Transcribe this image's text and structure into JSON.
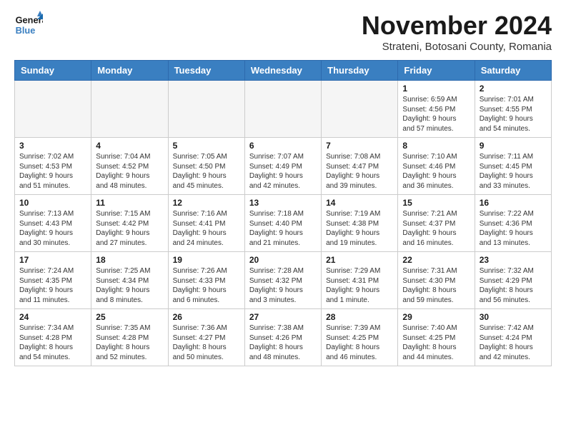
{
  "logo": {
    "text_general": "General",
    "text_blue": "Blue"
  },
  "header": {
    "month": "November 2024",
    "location": "Strateni, Botosani County, Romania"
  },
  "weekdays": [
    "Sunday",
    "Monday",
    "Tuesday",
    "Wednesday",
    "Thursday",
    "Friday",
    "Saturday"
  ],
  "weeks": [
    [
      {
        "day": "",
        "info": ""
      },
      {
        "day": "",
        "info": ""
      },
      {
        "day": "",
        "info": ""
      },
      {
        "day": "",
        "info": ""
      },
      {
        "day": "",
        "info": ""
      },
      {
        "day": "1",
        "info": "Sunrise: 6:59 AM\nSunset: 4:56 PM\nDaylight: 9 hours and 57 minutes."
      },
      {
        "day": "2",
        "info": "Sunrise: 7:01 AM\nSunset: 4:55 PM\nDaylight: 9 hours and 54 minutes."
      }
    ],
    [
      {
        "day": "3",
        "info": "Sunrise: 7:02 AM\nSunset: 4:53 PM\nDaylight: 9 hours and 51 minutes."
      },
      {
        "day": "4",
        "info": "Sunrise: 7:04 AM\nSunset: 4:52 PM\nDaylight: 9 hours and 48 minutes."
      },
      {
        "day": "5",
        "info": "Sunrise: 7:05 AM\nSunset: 4:50 PM\nDaylight: 9 hours and 45 minutes."
      },
      {
        "day": "6",
        "info": "Sunrise: 7:07 AM\nSunset: 4:49 PM\nDaylight: 9 hours and 42 minutes."
      },
      {
        "day": "7",
        "info": "Sunrise: 7:08 AM\nSunset: 4:47 PM\nDaylight: 9 hours and 39 minutes."
      },
      {
        "day": "8",
        "info": "Sunrise: 7:10 AM\nSunset: 4:46 PM\nDaylight: 9 hours and 36 minutes."
      },
      {
        "day": "9",
        "info": "Sunrise: 7:11 AM\nSunset: 4:45 PM\nDaylight: 9 hours and 33 minutes."
      }
    ],
    [
      {
        "day": "10",
        "info": "Sunrise: 7:13 AM\nSunset: 4:43 PM\nDaylight: 9 hours and 30 minutes."
      },
      {
        "day": "11",
        "info": "Sunrise: 7:15 AM\nSunset: 4:42 PM\nDaylight: 9 hours and 27 minutes."
      },
      {
        "day": "12",
        "info": "Sunrise: 7:16 AM\nSunset: 4:41 PM\nDaylight: 9 hours and 24 minutes."
      },
      {
        "day": "13",
        "info": "Sunrise: 7:18 AM\nSunset: 4:40 PM\nDaylight: 9 hours and 21 minutes."
      },
      {
        "day": "14",
        "info": "Sunrise: 7:19 AM\nSunset: 4:38 PM\nDaylight: 9 hours and 19 minutes."
      },
      {
        "day": "15",
        "info": "Sunrise: 7:21 AM\nSunset: 4:37 PM\nDaylight: 9 hours and 16 minutes."
      },
      {
        "day": "16",
        "info": "Sunrise: 7:22 AM\nSunset: 4:36 PM\nDaylight: 9 hours and 13 minutes."
      }
    ],
    [
      {
        "day": "17",
        "info": "Sunrise: 7:24 AM\nSunset: 4:35 PM\nDaylight: 9 hours and 11 minutes."
      },
      {
        "day": "18",
        "info": "Sunrise: 7:25 AM\nSunset: 4:34 PM\nDaylight: 9 hours and 8 minutes."
      },
      {
        "day": "19",
        "info": "Sunrise: 7:26 AM\nSunset: 4:33 PM\nDaylight: 9 hours and 6 minutes."
      },
      {
        "day": "20",
        "info": "Sunrise: 7:28 AM\nSunset: 4:32 PM\nDaylight: 9 hours and 3 minutes."
      },
      {
        "day": "21",
        "info": "Sunrise: 7:29 AM\nSunset: 4:31 PM\nDaylight: 9 hours and 1 minute."
      },
      {
        "day": "22",
        "info": "Sunrise: 7:31 AM\nSunset: 4:30 PM\nDaylight: 8 hours and 59 minutes."
      },
      {
        "day": "23",
        "info": "Sunrise: 7:32 AM\nSunset: 4:29 PM\nDaylight: 8 hours and 56 minutes."
      }
    ],
    [
      {
        "day": "24",
        "info": "Sunrise: 7:34 AM\nSunset: 4:28 PM\nDaylight: 8 hours and 54 minutes."
      },
      {
        "day": "25",
        "info": "Sunrise: 7:35 AM\nSunset: 4:28 PM\nDaylight: 8 hours and 52 minutes."
      },
      {
        "day": "26",
        "info": "Sunrise: 7:36 AM\nSunset: 4:27 PM\nDaylight: 8 hours and 50 minutes."
      },
      {
        "day": "27",
        "info": "Sunrise: 7:38 AM\nSunset: 4:26 PM\nDaylight: 8 hours and 48 minutes."
      },
      {
        "day": "28",
        "info": "Sunrise: 7:39 AM\nSunset: 4:25 PM\nDaylight: 8 hours and 46 minutes."
      },
      {
        "day": "29",
        "info": "Sunrise: 7:40 AM\nSunset: 4:25 PM\nDaylight: 8 hours and 44 minutes."
      },
      {
        "day": "30",
        "info": "Sunrise: 7:42 AM\nSunset: 4:24 PM\nDaylight: 8 hours and 42 minutes."
      }
    ]
  ]
}
